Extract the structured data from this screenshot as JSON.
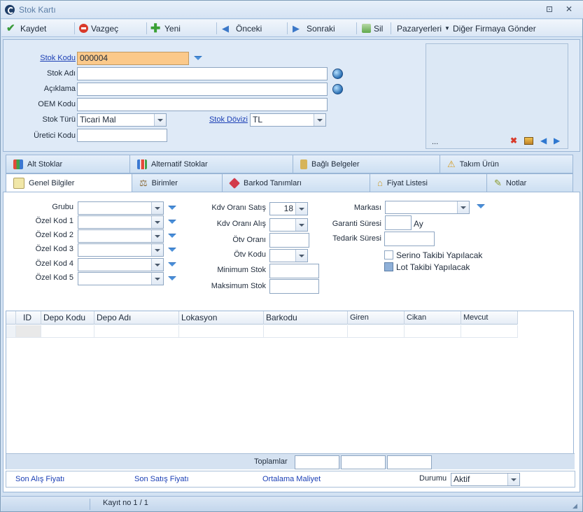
{
  "window": {
    "title": "Stok Kartı",
    "controls": [
      "⊡",
      "✕"
    ]
  },
  "toolbar": {
    "save": "Kaydet",
    "cancel": "Vazgeç",
    "new": "Yeni",
    "prev": "Önceki",
    "next": "Sonraki",
    "delete": "Sil",
    "marketplaces": "Pazaryerleri",
    "send_other_company": "Diğer Firmaya Gönder"
  },
  "form": {
    "stok_kodu_label": "Stok Kodu",
    "stok_kodu_value": "000004",
    "stok_adi_label": "Stok Adı",
    "stok_adi_value": "",
    "aciklama_label": "Açıklama",
    "aciklama_value": "",
    "oem_kodu_label": "OEM Kodu",
    "oem_kodu_value": "",
    "stok_turu_label": "Stok Türü",
    "stok_turu_value": "Ticari Mal",
    "stok_dovizi_label": "Stok Dövizi",
    "stok_dovizi_value": "TL",
    "uretici_kodu_label": "Üretici Kodu",
    "uretici_kodu_value": ""
  },
  "image_panel": {
    "caption": "..."
  },
  "tabs_top": [
    "Alt Stoklar",
    "Alternatif Stoklar",
    "Bağlı Belgeler",
    "Takım Ürün"
  ],
  "tabs_bottom": [
    "Genel Bilgiler",
    "Birimler",
    "Barkod Tanımları",
    "Fiyat Listesi",
    "Notlar"
  ],
  "genel": {
    "grubu": "Grubu",
    "ozel_kod_1": "Özel Kod 1",
    "ozel_kod_2": "Özel Kod 2",
    "ozel_kod_3": "Özel Kod 3",
    "ozel_kod_4": "Özel Kod 4",
    "ozel_kod_5": "Özel Kod 5",
    "kdv_satis_label": "Kdv Oranı Satış",
    "kdv_satis_value": "18",
    "kdv_alis_label": "Kdv Oranı Alış",
    "kdv_alis_value": "",
    "otv_orani_label": "Ötv Oranı",
    "otv_kodu_label": "Ötv Kodu",
    "min_stok_label": "Minimum Stok",
    "max_stok_label": "Maksimum Stok",
    "markasi_label": "Markası",
    "garanti_label": "Garanti Süresi",
    "garanti_unit": "Ay",
    "tedarik_label": "Tedarik Süresi",
    "serino_label": "Serino Takibi Yapılacak",
    "lot_label": "Lot Takibi Yapılacak"
  },
  "grid": {
    "columns": [
      "ID",
      "Depo Kodu",
      "Depo Adı",
      "Lokasyon",
      "Barkodu",
      "Giren",
      "Cikan",
      "Mevcut"
    ],
    "totals_label": "Toplamlar"
  },
  "bottom": {
    "son_alis": "Son Alış Fiyatı",
    "son_satis": "Son Satış Fiyatı",
    "ortalama": "Ortalama Maliyet",
    "durumu_label": "Durumu",
    "durumu_value": "Aktif"
  },
  "status": {
    "record": "Kayıt no 1 / 1"
  }
}
